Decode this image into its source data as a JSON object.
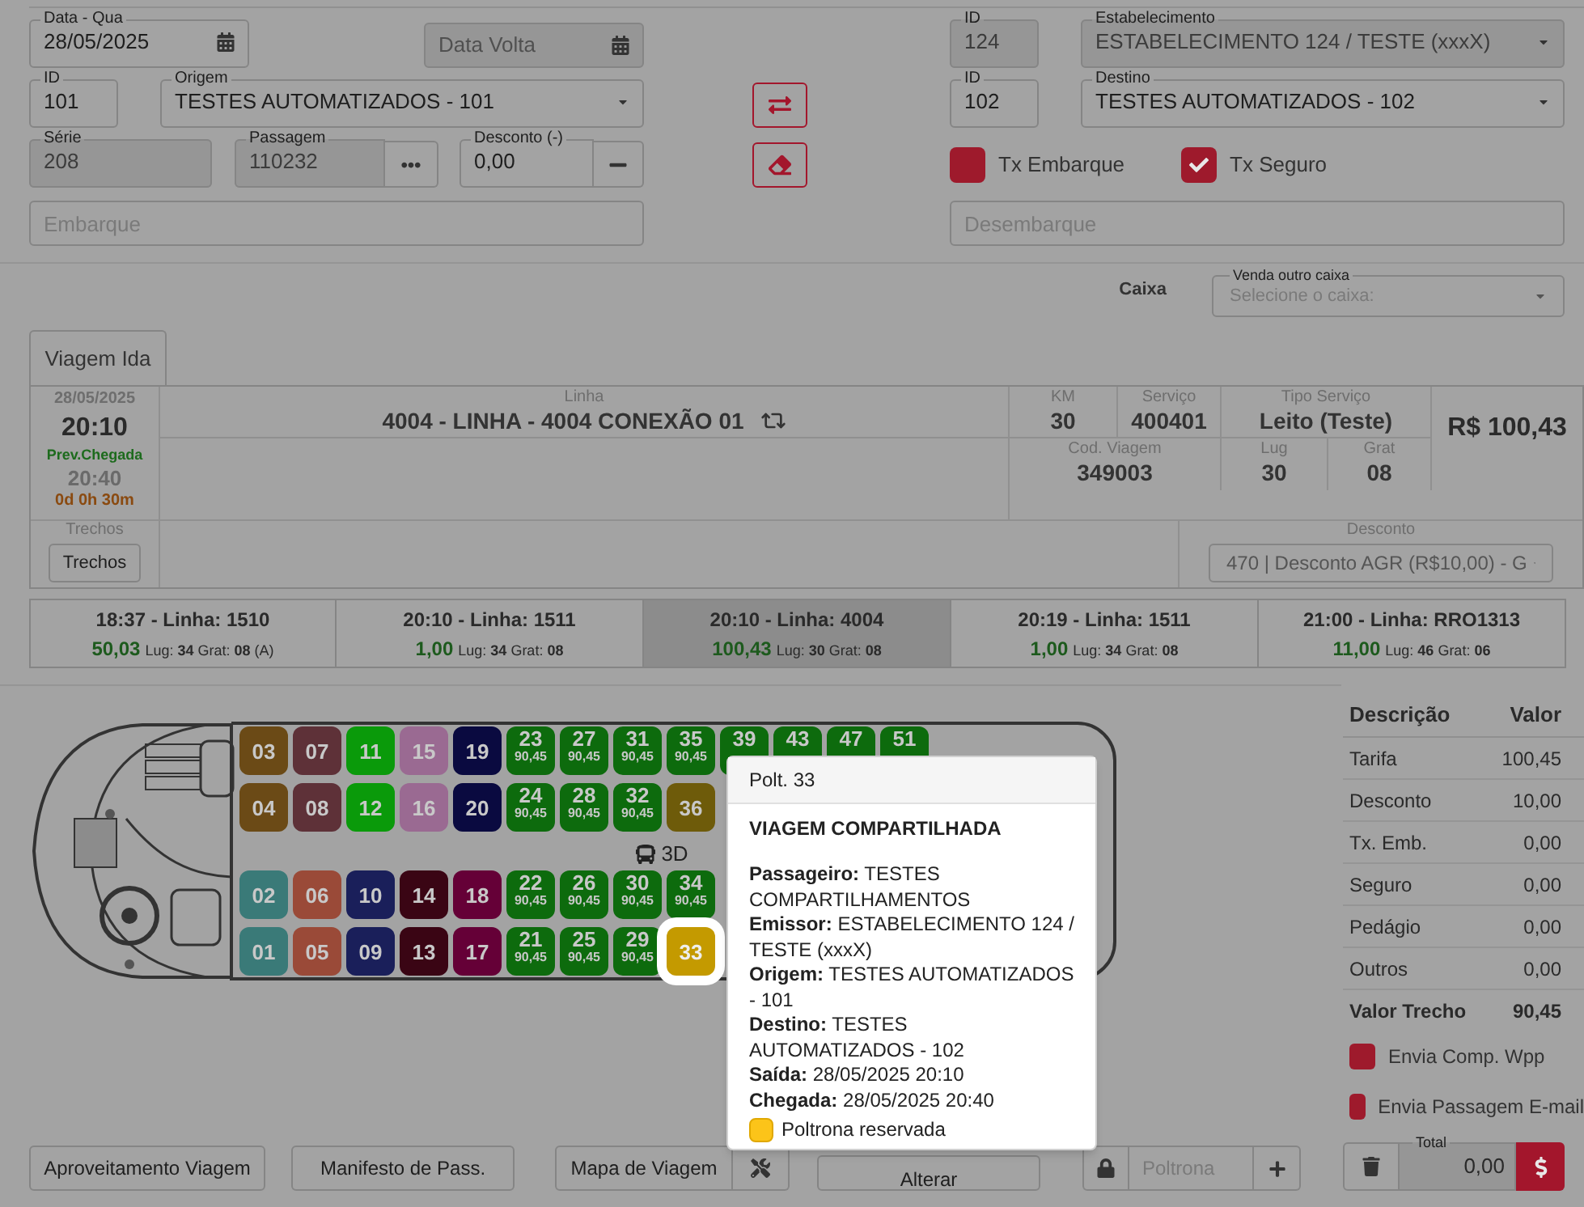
{
  "data_ida": {
    "label": "Data - Qua",
    "value": "28/05/2025"
  },
  "data_volta": {
    "placeholder": "Data Volta",
    "disabled": true
  },
  "origin_id": {
    "label": "ID",
    "value": "101",
    "disabled": false
  },
  "origin": {
    "label": "Origem",
    "value": "TESTES AUTOMATIZADOS - 101",
    "disabled": false
  },
  "serie": {
    "label": "Série",
    "value": "208",
    "disabled": true
  },
  "passagem": {
    "label": "Passagem",
    "value": "110232",
    "disabled": true
  },
  "desconto": {
    "label": "Desconto (-)",
    "value": "0,00",
    "disabled": false
  },
  "embarque": {
    "placeholder": "Embarque"
  },
  "estab_id": {
    "label": "ID",
    "value": "124",
    "disabled": true
  },
  "estabelecimento": {
    "label": "Estabelecimento",
    "value": "ESTABELECIMENTO 124 / TESTE (xxxX)",
    "disabled": true
  },
  "dest_id": {
    "label": "ID",
    "value": "102",
    "disabled": false
  },
  "destino": {
    "label": "Destino",
    "value": "TESTES AUTOMATIZADOS - 102",
    "disabled": false
  },
  "taxes": [
    {
      "label": "Tx Embarque",
      "checked": false
    },
    {
      "label": "Tx Seguro",
      "checked": true
    }
  ],
  "desembarque": {
    "placeholder": "Desembarque"
  },
  "caixa": {
    "label": "Caixa",
    "select_label": "Venda outro caixa",
    "placeholder": "Selecione o caixa:"
  },
  "tabs": [
    {
      "label": "Viagem Ida",
      "selected": true
    }
  ],
  "trip": {
    "date": "28/05/2025",
    "time": "20:10",
    "arrival_label": "Prev.Chegada",
    "arrival": "20:40",
    "duration": "0d 0h 30m",
    "linha_label": "Linha",
    "linha": "4004 - LINHA - 4004 CONEXÃO 01",
    "km": {
      "label": "KM",
      "value": "30"
    },
    "servico": {
      "label": "Serviço",
      "value": "400401"
    },
    "tipo": {
      "label": "Tipo Serviço",
      "value": "Leito (Teste)"
    },
    "cod": {
      "label": "Cod. Viagem",
      "value": "349003"
    },
    "lug": {
      "label": "Lug",
      "value": "30"
    },
    "grat": {
      "label": "Grat",
      "value": "08"
    },
    "price": "R$ 100,43",
    "trechos_label": "Trechos",
    "trechos_button": "Trechos",
    "desconto_label": "Desconto",
    "desconto_value": "470 | Desconto AGR (R$10,00) - G"
  },
  "trip_options": [
    {
      "title": "18:37 - Linha: 1510",
      "price": "50,03",
      "details": "Lug: **34** Grat: **08** (A)",
      "selected": false
    },
    {
      "title": "20:10 - Linha: 1511",
      "price": "1,00",
      "details": "Lug: **34** Grat: **08**",
      "selected": false
    },
    {
      "title": "20:10 - Linha: 4004",
      "price": "100,43",
      "details": "Lug: **30** Grat: **08**",
      "selected": true
    },
    {
      "title": "20:19 - Linha: 1511",
      "price": "1,00",
      "details": "Lug: **34** Grat: **08**",
      "selected": false
    },
    {
      "title": "21:00 - Linha: RRO1313",
      "price": "11,00",
      "details": "Lug: **46** Grat: **06**",
      "selected": false
    }
  ],
  "seat_map": {
    "deck": "3D",
    "rows": [
      [
        {
          "kind": "plain",
          "number": "03",
          "color": "#6b4a16",
          "selected": false
        },
        {
          "kind": "plain",
          "number": "07",
          "color": "#5e3138",
          "selected": false
        },
        {
          "kind": "plain",
          "number": "11",
          "color": "#0a9a0a",
          "selected": false
        },
        {
          "kind": "plain",
          "number": "15",
          "color": "#9a6a92",
          "selected": false
        },
        {
          "kind": "plain",
          "number": "19",
          "color": "#0a0a40",
          "selected": false
        },
        {
          "kind": "priced",
          "number": "23",
          "price": "90,45",
          "color": "#0d6b0d",
          "selected": false
        },
        {
          "kind": "priced",
          "number": "27",
          "price": "90,45",
          "color": "#0d6b0d",
          "selected": false
        },
        {
          "kind": "priced",
          "number": "31",
          "price": "90,45",
          "color": "#0d6b0d",
          "selected": false
        },
        {
          "kind": "priced",
          "number": "35",
          "price": "90,45",
          "color": "#0d6b0d",
          "selected": false
        },
        {
          "kind": "priced",
          "number": "39",
          "color": "#0d6b0d",
          "selected": false
        },
        {
          "kind": "priced",
          "number": "43",
          "color": "#0d6b0d",
          "selected": false
        },
        {
          "kind": "priced",
          "number": "47",
          "color": "#0d6b0d",
          "selected": false
        },
        {
          "kind": "priced",
          "number": "51",
          "color": "#0d6b0d",
          "selected": false
        }
      ],
      [
        {
          "kind": "plain",
          "number": "04",
          "color": "#6b4a16",
          "selected": false
        },
        {
          "kind": "plain",
          "number": "08",
          "color": "#5e3138",
          "selected": false
        },
        {
          "kind": "plain",
          "number": "12",
          "color": "#0a9a0a",
          "selected": false
        },
        {
          "kind": "plain",
          "number": "16",
          "color": "#9a6a92",
          "selected": false
        },
        {
          "kind": "plain",
          "number": "20",
          "color": "#0a0a40",
          "selected": false
        },
        {
          "kind": "priced",
          "number": "24",
          "price": "90,45",
          "color": "#0d6b0d",
          "selected": false
        },
        {
          "kind": "priced",
          "number": "28",
          "price": "90,45",
          "color": "#0d6b0d",
          "selected": false
        },
        {
          "kind": "priced",
          "number": "32",
          "price": "90,45",
          "color": "#0d6b0d",
          "selected": false
        },
        {
          "kind": "plain",
          "number": "36",
          "color": "#6e5b0a",
          "selected": false
        }
      ],
      [
        {
          "kind": "plain",
          "number": "02",
          "color": "#3a7a78",
          "selected": false
        },
        {
          "kind": "plain",
          "number": "06",
          "color": "#9a4a38",
          "selected": false
        },
        {
          "kind": "plain",
          "number": "10",
          "color": "#1a1f5a",
          "selected": false
        },
        {
          "kind": "plain",
          "number": "14",
          "color": "#3a0514",
          "selected": false
        },
        {
          "kind": "plain",
          "number": "18",
          "color": "#650037",
          "selected": false
        },
        {
          "kind": "priced",
          "number": "22",
          "price": "90,45",
          "color": "#0d6b0d",
          "selected": false
        },
        {
          "kind": "priced",
          "number": "26",
          "price": "90,45",
          "color": "#0d6b0d",
          "selected": false
        },
        {
          "kind": "priced",
          "number": "30",
          "price": "90,45",
          "color": "#0d6b0d",
          "selected": false
        },
        {
          "kind": "priced",
          "number": "34",
          "price": "90,45",
          "color": "#0d6b0d",
          "selected": false
        }
      ],
      [
        {
          "kind": "plain",
          "number": "01",
          "color": "#3a7a78",
          "selected": false
        },
        {
          "kind": "plain",
          "number": "05",
          "color": "#9a4a38",
          "selected": false
        },
        {
          "kind": "plain",
          "number": "09",
          "color": "#1a1f5a",
          "selected": false
        },
        {
          "kind": "plain",
          "number": "13",
          "color": "#3a0514",
          "selected": false
        },
        {
          "kind": "plain",
          "number": "17",
          "color": "#650037",
          "selected": false
        },
        {
          "kind": "priced",
          "number": "21",
          "price": "90,45",
          "color": "#0d6b0d",
          "selected": false
        },
        {
          "kind": "priced",
          "number": "25",
          "price": "90,45",
          "color": "#0d6b0d",
          "selected": false
        },
        {
          "kind": "priced",
          "number": "29",
          "price": "90,45",
          "color": "#0d6b0d",
          "selected": false
        },
        {
          "kind": "plain",
          "number": "33",
          "color": "#c49a00",
          "selected": true
        }
      ]
    ]
  },
  "tooltip": {
    "title": "Polt. 33",
    "heading": "VIAGEM COMPARTILHADA",
    "lines": [
      {
        "label": "Passageiro:",
        "value": "TESTES COMPARTILHAMENTOS"
      },
      {
        "label": "Emissor:",
        "value": "ESTABELECIMENTO 124 / TESTE (xxxX)"
      },
      {
        "label": "Origem:",
        "value": "TESTES AUTOMATIZADOS - 101"
      },
      {
        "label": "Destino:",
        "value": "TESTES AUTOMATIZADOS - 102"
      },
      {
        "label": "Saída:",
        "value": "28/05/2025 20:10"
      },
      {
        "label": "Chegada:",
        "value": "28/05/2025 20:40"
      }
    ],
    "legend": "Poltrona reservada"
  },
  "summary": {
    "header": [
      "Descrição",
      "Valor"
    ],
    "rows": [
      {
        "label": "Tarifa",
        "value": "100,45"
      },
      {
        "label": "Desconto",
        "value": "10,00"
      },
      {
        "label": "Tx. Emb.",
        "value": "0,00"
      },
      {
        "label": "Seguro",
        "value": "0,00"
      },
      {
        "label": "Pedágio",
        "value": "0,00"
      },
      {
        "label": "Outros",
        "value": "0,00"
      }
    ],
    "total_row": {
      "label": "Valor Trecho",
      "value": "90,45"
    },
    "options": [
      {
        "label": "Envia Comp. Wpp",
        "checked": false
      },
      {
        "label": "Envia Passagem E-mail",
        "checked": false
      }
    ],
    "total_label": "Total",
    "total": "0,00"
  },
  "buttons": {
    "aproveitamento": "Aproveitamento Viagem",
    "manifesto": "Manifesto de Pass.",
    "mapa": "Mapa de Viagem",
    "alterar": "Alterar",
    "poltrona_placeholder": "Poltrona"
  }
}
